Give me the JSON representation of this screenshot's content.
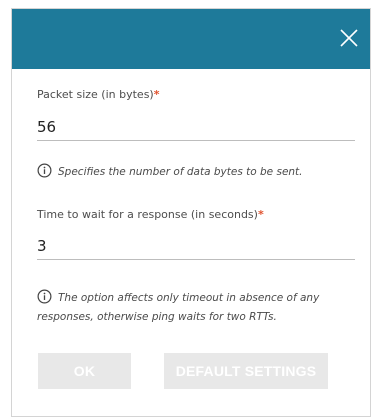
{
  "dialog": {
    "header_color": "#1e7a9a",
    "close_icon": "close-icon"
  },
  "fields": {
    "packet_size": {
      "label": "Packet size (in bytes)",
      "required_mark": "*",
      "value": "56",
      "hint": "Specifies the number of data bytes to be sent.",
      "hint_icon": "info-icon"
    },
    "timeout": {
      "label": "Time to wait for a response (in seconds)",
      "required_mark": "*",
      "value": "3",
      "hint": "The option affects only timeout in absence of any responses, otherwise ping waits for two RTTs.",
      "hint_icon": "info-icon"
    }
  },
  "buttons": {
    "ok_label": "OK",
    "default_settings_label": "DEFAULT SETTINGS"
  }
}
